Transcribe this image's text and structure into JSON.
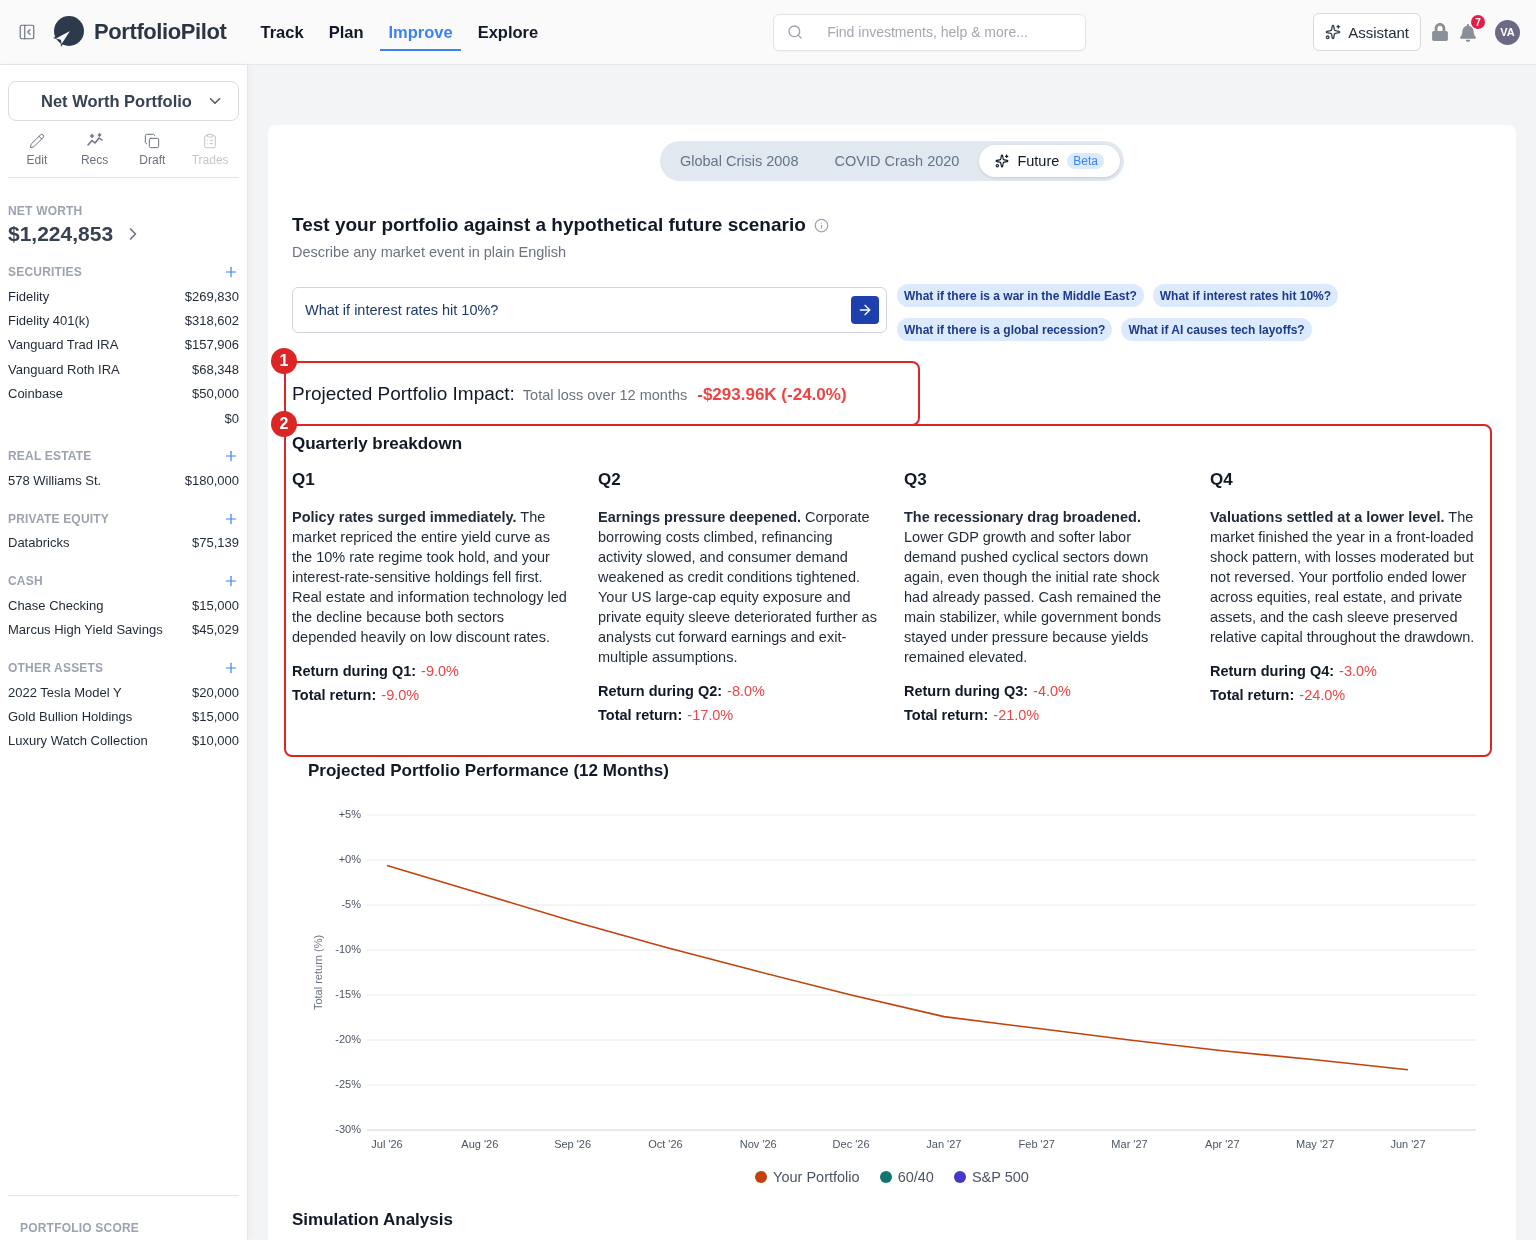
{
  "header": {
    "brand": "PortfolioPilot",
    "nav": [
      {
        "label": "Track",
        "selected": false
      },
      {
        "label": "Plan",
        "selected": false
      },
      {
        "label": "Improve",
        "selected": true
      },
      {
        "label": "Explore",
        "selected": false
      }
    ],
    "search": {
      "placeholder": "Find investments, help & more..."
    },
    "assistant_button": "Assistant",
    "notification_count": "7",
    "avatar": "VA"
  },
  "sidebar": {
    "portfolio_select": "Net Worth Portfolio",
    "actions": [
      {
        "label": "Edit",
        "disabled": false
      },
      {
        "label": "Recs",
        "disabled": false
      },
      {
        "label": "Draft",
        "disabled": false
      },
      {
        "label": "Trades",
        "disabled": true
      }
    ],
    "net_worth": {
      "label": "NET WORTH",
      "value": "$1,224,853"
    },
    "sections": [
      {
        "title": "SECURITIES",
        "items": [
          {
            "name": "Fidelity",
            "value": "$269,830"
          },
          {
            "name": "Fidelity 401(k)",
            "value": "$318,602"
          },
          {
            "name": "Vanguard Trad IRA",
            "value": "$157,906"
          },
          {
            "name": "Vanguard Roth IRA",
            "value": "$68,348"
          },
          {
            "name": "Coinbase",
            "value": "$50,000"
          },
          {
            "value": "$0"
          }
        ]
      },
      {
        "title": "REAL ESTATE",
        "items": [
          {
            "name": "578 Williams St.",
            "value": "$180,000"
          }
        ]
      },
      {
        "title": "PRIVATE EQUITY",
        "items": [
          {
            "name": "Databricks",
            "value": "$75,139"
          }
        ]
      },
      {
        "title": "CASH",
        "items": [
          {
            "name": "Chase Checking",
            "value": "$15,000"
          },
          {
            "name": "Marcus High Yield Savings",
            "value": "$45,029"
          }
        ]
      },
      {
        "title": "OTHER ASSETS",
        "items": [
          {
            "name": "2022 Tesla Model Y",
            "value": "$20,000"
          },
          {
            "name": "Gold Bullion Holdings",
            "value": "$15,000"
          },
          {
            "name": "Luxury Watch Collection",
            "value": "$10,000"
          }
        ]
      }
    ],
    "footer_title": "PORTFOLIO SCORE"
  },
  "scenario_tabs": [
    {
      "label": "Global Crisis 2008",
      "selected": false,
      "kind": "historical"
    },
    {
      "label": "COVID Crash 2020",
      "selected": false,
      "kind": "historical"
    },
    {
      "label": "Future",
      "selected": true,
      "kind": "ai",
      "badge": "Beta"
    }
  ],
  "prompt": {
    "title": "Test your portfolio against a hypothetical future scenario",
    "subtitle": "Describe any market event in plain English",
    "input": {
      "value": "What if interest rates hit 10%?"
    },
    "suggestions": [
      "What if there is a war in the Middle East?",
      "What if interest rates hit 10%?",
      "What if there is a global recession?",
      "What if AI causes tech layoffs?"
    ]
  },
  "impact": {
    "callout": "1",
    "label": "Projected Portfolio Impact:",
    "caption": "Total loss over 12 months",
    "value": "-$293.96K (-24.0%)"
  },
  "quarterly": {
    "callout": "2",
    "title": "Quarterly breakdown",
    "quarters": [
      {
        "title": "Q1",
        "text": "**Policy rates surged immediately.** The market repriced the entire yield curve as the 10% rate regime took hold, and your interest-rate-sensitive holdings fell first. Real estate and information technology led the decline because both sectors depended heavily on low discount rates.",
        "stats": [
          {
            "label": "Return during Q1:",
            "value": "-9.0%"
          },
          {
            "label": "Total return:",
            "value": "-9.0%"
          }
        ]
      },
      {
        "title": "Q2",
        "text": "**Earnings pressure deepened.** Corporate borrowing costs climbed, refinancing activity slowed, and consumer demand weakened as credit conditions tightened. Your US large-cap equity exposure and private equity sleeve deteriorated further as analysts cut forward earnings and exit-multiple assumptions.",
        "stats": [
          {
            "label": "Return during Q2:",
            "value": "-8.0%"
          },
          {
            "label": "Total return:",
            "value": "-17.0%"
          }
        ]
      },
      {
        "title": "Q3",
        "text": "**The recessionary drag broadened.** Lower GDP growth and softer labor demand pushed cyclical sectors down again, even though the initial rate shock had already passed. Cash remained the main stabilizer, while government bonds stayed under pressure because yields remained elevated.",
        "stats": [
          {
            "label": "Return during Q3:",
            "value": "-4.0%"
          },
          {
            "label": "Total return:",
            "value": "-21.0%"
          }
        ]
      },
      {
        "title": "Q4",
        "text": "**Valuations settled at a lower level.** The market finished the year in a front-loaded shock pattern, with losses moderated but not reversed. Your portfolio ended lower across equities, real estate, and private assets, and the cash sleeve preserved relative capital throughout the drawdown.",
        "stats": [
          {
            "label": "Return during Q4:",
            "value": "-3.0%"
          },
          {
            "label": "Total return:",
            "value": "-24.0%"
          }
        ]
      }
    ]
  },
  "performance": {
    "chart_data": {
      "type": "line",
      "title": "Projected Portfolio Performance (12 Months)",
      "ylabel": "Total return (%)",
      "grid": true,
      "categories": [
        "Jul '26",
        "Aug '26",
        "Sep '26",
        "Oct '26",
        "Nov '26",
        "Dec '26",
        "Jan '27",
        "Feb '27",
        "Mar '27",
        "Apr '27",
        "May '27",
        "Jun '27"
      ],
      "ylim": [
        -30,
        5
      ],
      "yticks": [
        {
          "value": 5,
          "label": "+5%"
        },
        {
          "value": 0,
          "label": "+0%"
        },
        {
          "value": -5,
          "label": "-5%"
        },
        {
          "value": -10,
          "label": "-10%"
        },
        {
          "value": -15,
          "label": "-15%"
        },
        {
          "value": -20,
          "label": "-20%"
        },
        {
          "value": -25,
          "label": "-25%"
        },
        {
          "value": -30,
          "label": "-30%"
        }
      ],
      "series": [
        {
          "name": "Your Portfolio",
          "color": "#c2410c",
          "values": [
            -0.6,
            -3.7,
            -6.8,
            -9.7,
            -12.4,
            -15.0,
            -17.4,
            -18.7,
            -20.0,
            -21.2,
            -22.2,
            -23.3
          ]
        },
        {
          "name": "60/40",
          "color": "#0f766e",
          "values": [
            null,
            null,
            null,
            null,
            null,
            null,
            null,
            null,
            null,
            null,
            null,
            null
          ]
        },
        {
          "name": "S&P 500",
          "color": "#4338ca",
          "values": [
            null,
            null,
            null,
            null,
            null,
            null,
            null,
            null,
            null,
            null,
            null,
            null
          ]
        }
      ]
    }
  },
  "analysis": {
    "title": "Simulation Analysis"
  }
}
